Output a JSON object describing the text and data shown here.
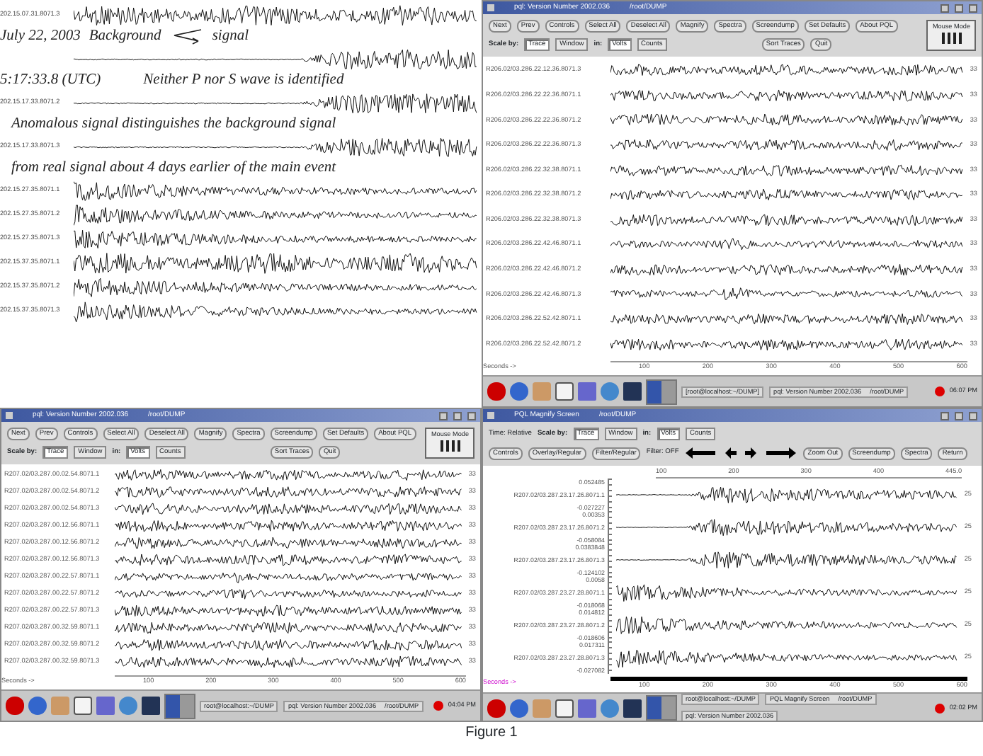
{
  "annotated_panel": {
    "rows": [
      {
        "kind": "noise",
        "label": "202.15.07.31.8071.3"
      },
      {
        "kind": "callout",
        "date": "July 22, 2003",
        "left": "Background",
        "right": "signal"
      },
      {
        "kind": "onset"
      },
      {
        "kind": "note",
        "time": "5:17:33.8 (UTC)",
        "text": "Neither P nor S wave is identified"
      },
      {
        "kind": "onset",
        "label": "202.15.17.33.8071.2"
      },
      {
        "kind": "note",
        "text": "Anomalous signal distinguishes the background signal"
      },
      {
        "kind": "onset",
        "label": "202.15.17.33.8071.3"
      },
      {
        "kind": "note",
        "text": "from real signal about 4 days earlier of the main event"
      },
      {
        "kind": "decay",
        "label": "202.15.27.35.8071.1"
      },
      {
        "kind": "decay",
        "label": "202.15.27.35.8071.2"
      },
      {
        "kind": "decay",
        "label": "202.15.27.35.8071.3"
      },
      {
        "kind": "noise",
        "label": "202.15.37.35.8071.1"
      },
      {
        "kind": "decay",
        "label": "202.15.37.35.8071.2"
      },
      {
        "kind": "decay",
        "label": "202.15.37.35.8071.3"
      }
    ]
  },
  "windows": [
    {
      "kind": "main",
      "title": "pql: Version Number 2002.036",
      "path": "/root/DUMP",
      "buttons": [
        "Next",
        "Prev",
        "Controls",
        "Select All",
        "Deselect All",
        "Magnify",
        "Spectra",
        "Screendump",
        "Set Defaults",
        "About PQL"
      ],
      "scale_label": "Scale by:",
      "scale_by": [
        {
          "label": "Trace",
          "selected": true
        },
        {
          "label": "Window",
          "selected": false
        }
      ],
      "units_label": "in:",
      "units": [
        {
          "label": "Volts",
          "selected": true
        },
        {
          "label": "Counts",
          "selected": false
        }
      ],
      "actions": [
        "Sort Traces",
        "Quit"
      ],
      "mouse_mode": "Mouse Mode",
      "traces": [
        {
          "label": "R206.02/03.286.22.12.36.8071.3",
          "count": "33",
          "kind": "noise"
        },
        {
          "label": "R206.02/03.286.22.22.36.8071.1",
          "count": "33",
          "kind": "noise"
        },
        {
          "label": "R206.02/03.286.22.22.36.8071.2",
          "count": "33",
          "kind": "noise"
        },
        {
          "label": "R206.02/03.286.22.22.36.8071.3",
          "count": "33",
          "kind": "noise"
        },
        {
          "label": "R206.02/03.286.22.32.38.8071.1",
          "count": "33",
          "kind": "noise"
        },
        {
          "label": "R206.02/03.286.22.32.38.8071.2",
          "count": "33",
          "kind": "noise"
        },
        {
          "label": "R206.02/03.286.22.32.38.8071.3",
          "count": "33",
          "kind": "noise"
        },
        {
          "label": "R206.02/03.286.22.42.46.8071.1",
          "count": "33",
          "kind": "burst"
        },
        {
          "label": "R206.02/03.286.22.42.46.8071.2",
          "count": "33",
          "kind": "noise"
        },
        {
          "label": "R206.02/03.286.22.42.46.8071.3",
          "count": "33",
          "kind": "burst"
        },
        {
          "label": "R206.02/03.286.22.52.42.8071.1",
          "count": "33",
          "kind": "noise"
        },
        {
          "label": "R206.02/03.286.22.52.42.8071.2",
          "count": "33",
          "kind": "noise"
        }
      ],
      "axis": {
        "caption": "Seconds ->",
        "ticks": [
          "100",
          "200",
          "300",
          "400",
          "500",
          "600"
        ]
      },
      "taskbar": {
        "tasks": [
          {
            "text": "[root@localhost:~/DUMP]"
          },
          {
            "text": "pql: Version Number 2002.036",
            "path": "/root/DUMP"
          }
        ],
        "clock": "06:07 PM"
      }
    },
    {
      "kind": "main",
      "title": "pql: Version Number 2002.036",
      "path": "/root/DUMP",
      "buttons": [
        "Next",
        "Prev",
        "Controls",
        "Select All",
        "Deselect All",
        "Magnify",
        "Spectra",
        "Screendump",
        "Set Defaults",
        "About PQL"
      ],
      "scale_label": "Scale by:",
      "scale_by": [
        {
          "label": "Trace",
          "selected": true
        },
        {
          "label": "Window",
          "selected": false
        }
      ],
      "units_label": "in:",
      "units": [
        {
          "label": "Volts",
          "selected": true
        },
        {
          "label": "Counts",
          "selected": false
        }
      ],
      "actions": [
        "Sort Traces",
        "Quit"
      ],
      "mouse_mode": "Mouse Mode",
      "traces": [
        {
          "label": "R207.02/03.287.00.02.54.8071.1",
          "count": "33",
          "kind": "noise"
        },
        {
          "label": "R207.02/03.287.00.02.54.8071.2",
          "count": "33",
          "kind": "noise"
        },
        {
          "label": "R207.02/03.287.00.02.54.8071.3",
          "count": "33",
          "kind": "noise"
        },
        {
          "label": "R207.02/03.287.00.12.56.8071.1",
          "count": "33",
          "kind": "noise"
        },
        {
          "label": "R207.02/03.287.00.12.56.8071.2",
          "count": "33",
          "kind": "noise"
        },
        {
          "label": "R207.02/03.287.00.12.56.8071.3",
          "count": "33",
          "kind": "noise"
        },
        {
          "label": "R207.02/03.287.00.22.57.8071.1",
          "count": "33",
          "kind": "burst"
        },
        {
          "label": "R207.02/03.287.00.22.57.8071.2",
          "count": "33",
          "kind": "burst"
        },
        {
          "label": "R207.02/03.287.00.22.57.8071.3",
          "count": "33",
          "kind": "noise"
        },
        {
          "label": "R207.02/03.287.00.32.59.8071.1",
          "count": "33",
          "kind": "noise"
        },
        {
          "label": "R207.02/03.287.00.32.59.8071.2",
          "count": "33",
          "kind": "noise"
        },
        {
          "label": "R207.02/03.287.00.32.59.8071.3",
          "count": "33",
          "kind": "noise"
        }
      ],
      "axis": {
        "caption": "Seconds ->",
        "ticks": [
          "100",
          "200",
          "300",
          "400",
          "500",
          "600"
        ]
      },
      "taskbar": {
        "tasks": [
          {
            "text": "root@localhost:~/DUMP"
          },
          {
            "text": "pql: Version Number 2002.036",
            "path": "/root/DUMP"
          }
        ],
        "clock": "04:04 PM"
      }
    },
    {
      "kind": "magnify",
      "title": "PQL Magnify Screen",
      "path": "/root/DUMP",
      "time_mode": "Time: Relative",
      "scale_label": "Scale by:",
      "scale_by": [
        {
          "label": "Trace",
          "selected": true
        },
        {
          "label": "Window",
          "selected": false
        }
      ],
      "units_label": "in:",
      "units": [
        {
          "label": "Volts",
          "selected": true
        },
        {
          "label": "Counts",
          "selected": false
        }
      ],
      "buttons": [
        "Controls",
        "Overlay/Regular",
        "Filter/Regular"
      ],
      "filter": "Filter: OFF",
      "buttons_right": [
        "Zoom Out",
        "Screendump",
        "Spectra",
        "Return"
      ],
      "top_ticks": [
        "100",
        "200",
        "300",
        "400",
        "445.0"
      ],
      "traces": [
        {
          "max": "0.052485",
          "label": "R207.02/03.287.23.17.26.8071.1",
          "min": "-0.027227",
          "count": "25",
          "kind": "early_onset"
        },
        {
          "max": "0.00353",
          "label": "R207.02/03.287.23.17.26.8071.2",
          "min": "-0.058084",
          "count": "25",
          "kind": "early_onset"
        },
        {
          "max": "0.0383848",
          "label": "R207.02/03.287.23.17.26.8071.3",
          "min": "-0.124102",
          "count": "25",
          "kind": "early_onset"
        },
        {
          "max": "0.0058",
          "label": "R207.02/03.287.23.27.28.8071.1",
          "min": "-0.018068",
          "count": "25",
          "kind": "decay"
        },
        {
          "max": "0.014812",
          "label": "R207.02/03.287.23.27.28.8071.2",
          "min": "-0.018606",
          "count": "25",
          "kind": "decay"
        },
        {
          "max": "0.017311",
          "label": "R207.02/03.287.23.27.28.8071.3",
          "min": "-0.027082",
          "count": "25",
          "kind": "decay"
        }
      ],
      "axis": {
        "caption": "Seconds ->",
        "ticks": [
          "100",
          "200",
          "300",
          "400",
          "500",
          "600"
        ]
      },
      "taskbar": {
        "tasks": [
          {
            "text": "root@localhost:~/DUMP"
          },
          {
            "text": "PQL Magnify Screen",
            "path": "/root/DUMP"
          },
          {
            "text": "pql: Version Number 2002.036"
          }
        ],
        "clock": "02:02 PM"
      }
    }
  ],
  "caption": "Figure 1"
}
